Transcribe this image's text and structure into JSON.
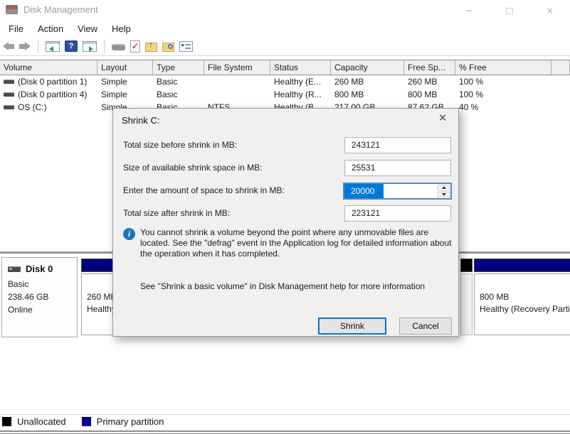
{
  "window": {
    "title": "Disk Management",
    "controls": {
      "minimize": "−",
      "maximize": "□",
      "close": "×"
    }
  },
  "menu": {
    "items": [
      "File",
      "Action",
      "View",
      "Help"
    ]
  },
  "toolbar": {
    "icons": [
      "back",
      "forward",
      "show-console-tree",
      "help",
      "show-action-pane",
      "device",
      "check-disk",
      "export-folder",
      "search-folder",
      "properties"
    ],
    "help_glyph": "?",
    "check_glyph": "✓",
    "up_arrow_glyph": "↑"
  },
  "volume_table": {
    "columns": [
      "Volume",
      "Layout",
      "Type",
      "File System",
      "Status",
      "Capacity",
      "Free Sp...",
      "% Free"
    ],
    "rows": [
      {
        "volume": "(Disk 0 partition 1)",
        "layout": "Simple",
        "type": "Basic",
        "fs": "",
        "status": "Healthy (E...",
        "capacity": "260 MB",
        "free": "260 MB",
        "pct": "100 %"
      },
      {
        "volume": "(Disk 0 partition 4)",
        "layout": "Simple",
        "type": "Basic",
        "fs": "",
        "status": "Healthy (R...",
        "capacity": "800 MB",
        "free": "800 MB",
        "pct": "100 %"
      },
      {
        "volume": "OS (C:)",
        "layout": "Simple",
        "type": "Basic",
        "fs": "NTFS",
        "status": "Healthy (B...",
        "capacity": "217.00 GB",
        "free": "87.62 GB",
        "pct": "40 %"
      }
    ]
  },
  "shrink_dialog": {
    "title": "Shrink C:",
    "close_glyph": "×",
    "fields": [
      {
        "label": "Total size before shrink in MB:",
        "value": "243121"
      },
      {
        "label": "Size of available shrink space in MB:",
        "value": "25531"
      },
      {
        "label": "Enter the amount of space to shrink in MB:",
        "value": "20000"
      },
      {
        "label": "Total size after shrink in MB:",
        "value": "223121"
      }
    ],
    "info_icon_glyph": "i",
    "info_text": "You cannot shrink a volume beyond the point where any unmovable files are located. See the \"defrag\" event in the Application log for detailed information about the operation when it has completed.",
    "help_text": "See \"Shrink a basic volume\" in Disk Management help for more information",
    "buttons": {
      "shrink": "Shrink",
      "cancel": "Cancel"
    }
  },
  "disk_panel": {
    "disk": {
      "name": "Disk 0",
      "type": "Basic",
      "size": "238.46 GB",
      "status": "Online"
    },
    "partitions": [
      {
        "size": "260 MB",
        "status": "Healthy (EFI System Partition)"
      },
      {
        "size": "",
        "status": ""
      },
      {
        "size": "800 MB",
        "status": "Healthy (Recovery Partition)"
      }
    ]
  },
  "legend": {
    "items": [
      {
        "label": "Unallocated",
        "color": "#000000"
      },
      {
        "label": "Primary partition",
        "color": "#00008b"
      }
    ]
  },
  "colors": {
    "accent": "#0078d7",
    "primary_partition": "#000080",
    "unallocated": "#000000",
    "selection": "#0078d7"
  }
}
